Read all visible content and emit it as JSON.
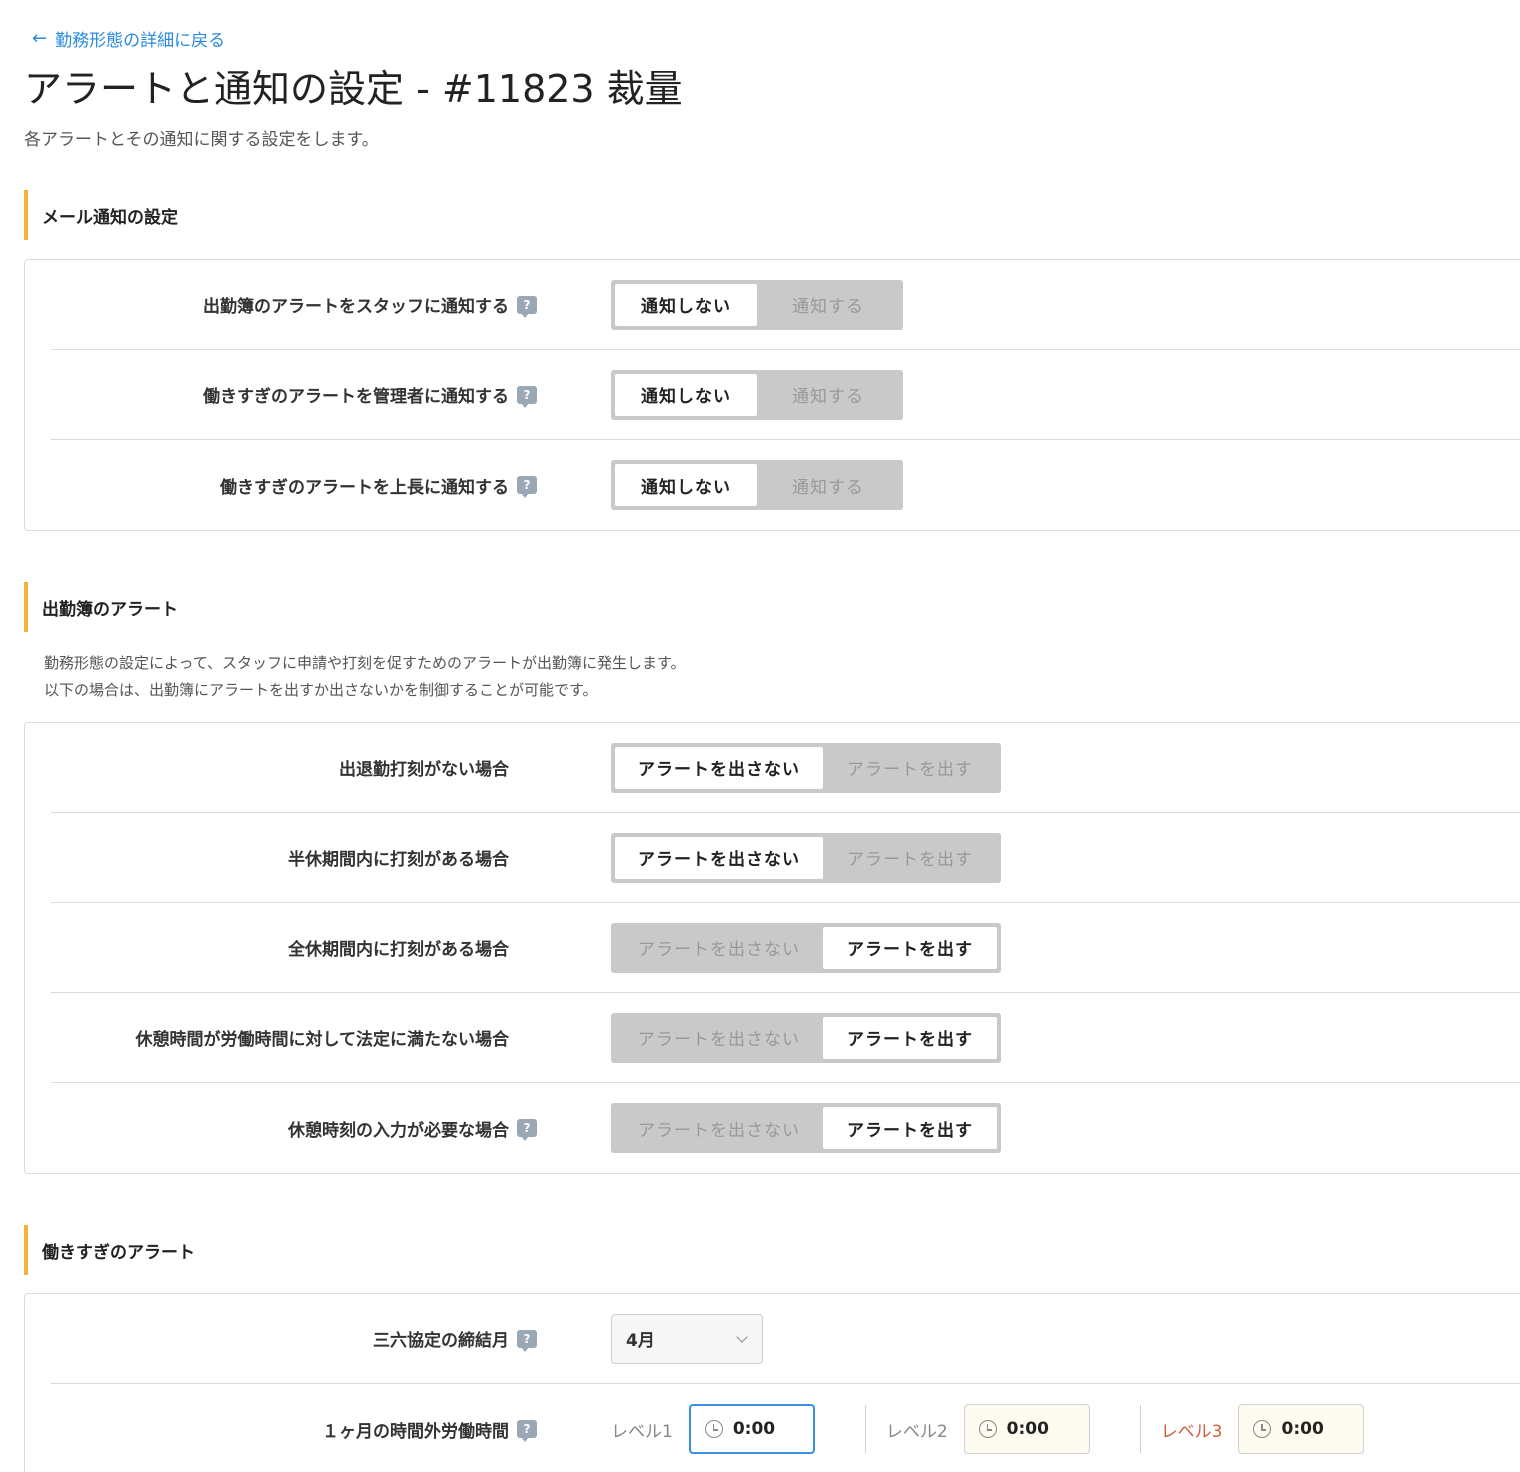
{
  "nav": {
    "back_label": "勤務形態の詳細に戻る"
  },
  "page": {
    "title": "アラートと通知の設定 - #11823 裁量",
    "description": "各アラートとその通知に関する設定をします。"
  },
  "mail_section": {
    "title": "メール通知の設定",
    "rows": [
      {
        "label": "出勤簿のアラートをスタッフに通知する",
        "off_label": "通知しない",
        "on_label": "通知する",
        "selected": "off"
      },
      {
        "label": "働きすぎのアラートを管理者に通知する",
        "off_label": "通知しない",
        "on_label": "通知する",
        "selected": "off"
      },
      {
        "label": "働きすぎのアラートを上長に通知する",
        "off_label": "通知しない",
        "on_label": "通知する",
        "selected": "off"
      }
    ]
  },
  "attendance_section": {
    "title": "出勤簿のアラート",
    "note_line1": "勤務形態の設定によって、スタッフに申請や打刻を促すためのアラートが出勤簿に発生します。",
    "note_line2": "以下の場合は、出勤簿にアラートを出すか出さないかを制御することが可能です。",
    "rows": [
      {
        "label": "出退勤打刻がない場合",
        "off_label": "アラートを出さない",
        "on_label": "アラートを出す",
        "selected": "off"
      },
      {
        "label": "半休期間内に打刻がある場合",
        "off_label": "アラートを出さない",
        "on_label": "アラートを出す",
        "selected": "off"
      },
      {
        "label": "全休期間内に打刻がある場合",
        "off_label": "アラートを出さない",
        "on_label": "アラートを出す",
        "selected": "on"
      },
      {
        "label": "休憩時間が労働時間に対して法定に満たない場合",
        "off_label": "アラートを出さない",
        "on_label": "アラートを出す",
        "selected": "on"
      },
      {
        "label": "休憩時刻の入力が必要な場合",
        "off_label": "アラートを出さない",
        "on_label": "アラートを出す",
        "selected": "on"
      }
    ]
  },
  "overwork_section": {
    "title": "働きすぎのアラート",
    "agreement_month": {
      "label": "三六協定の締結月",
      "value": "4月"
    },
    "monthly_overtime": {
      "label": "１ヶ月の時間外労働時間",
      "levels": [
        {
          "label": "レベル1",
          "value": "0:00"
        },
        {
          "label": "レベル2",
          "value": "0:00"
        },
        {
          "label": "レベル3",
          "value": "0:00"
        }
      ]
    }
  },
  "colors": {
    "link": "#2a8ae0",
    "accent": "#f3b23b",
    "danger": "#d0603f",
    "focus": "#3b8fe0"
  }
}
